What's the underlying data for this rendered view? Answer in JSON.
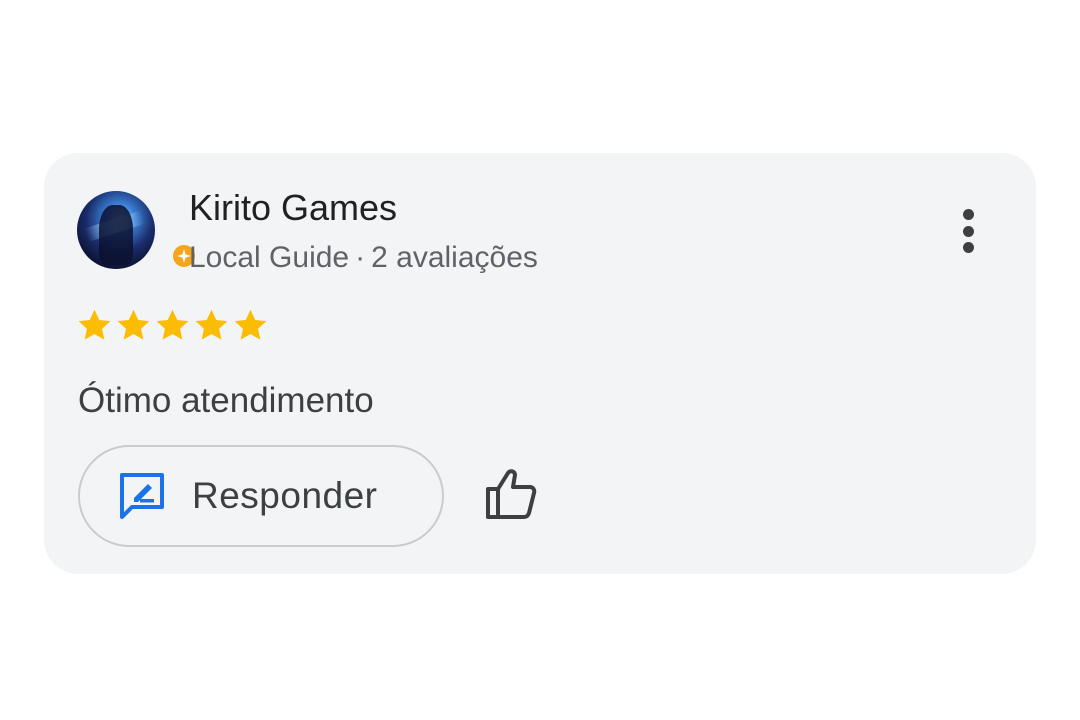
{
  "review": {
    "author_name": "Kirito Games",
    "author_level": "Local Guide",
    "separator": "·",
    "review_count": "2 avaliações",
    "rating": 5,
    "rating_max": 5,
    "text": "Ótimo atendimento",
    "reply_label": "Responder"
  },
  "colors": {
    "star": "#fbbc04",
    "reply_icon": "#1a73e8",
    "badge": "#f4a51c",
    "card_bg": "#f3f4f6"
  },
  "icons": {
    "avatar": "user-avatar-image",
    "badge": "local-guide-badge-icon",
    "more": "more-vertical-icon",
    "reply": "reply-icon",
    "like": "thumbs-up-icon"
  }
}
